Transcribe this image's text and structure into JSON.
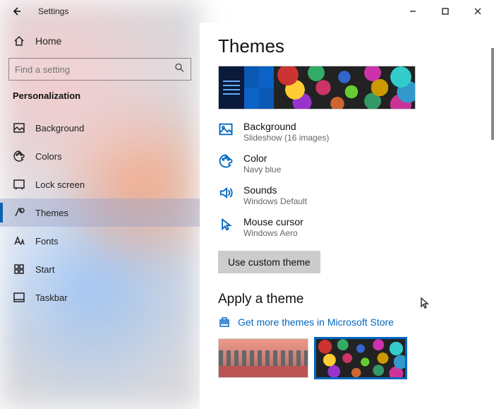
{
  "window": {
    "title": "Settings",
    "home_label": "Home",
    "search_placeholder": "Find a setting",
    "category": "Personalization",
    "nav": [
      {
        "id": "background",
        "label": "Background"
      },
      {
        "id": "colors",
        "label": "Colors"
      },
      {
        "id": "lock-screen",
        "label": "Lock screen"
      },
      {
        "id": "themes",
        "label": "Themes",
        "selected": true
      },
      {
        "id": "fonts",
        "label": "Fonts"
      },
      {
        "id": "start",
        "label": "Start"
      },
      {
        "id": "taskbar",
        "label": "Taskbar"
      }
    ]
  },
  "page": {
    "title": "Themes",
    "properties": {
      "background": {
        "title": "Background",
        "value": "Slideshow (16 images)"
      },
      "color": {
        "title": "Color",
        "value": "Navy blue"
      },
      "sounds": {
        "title": "Sounds",
        "value": "Windows Default"
      },
      "cursor": {
        "title": "Mouse cursor",
        "value": "Windows Aero"
      }
    },
    "use_theme_button": "Use custom theme",
    "apply": {
      "heading": "Apply a theme",
      "store_link": "Get more themes in Microsoft Store"
    }
  }
}
